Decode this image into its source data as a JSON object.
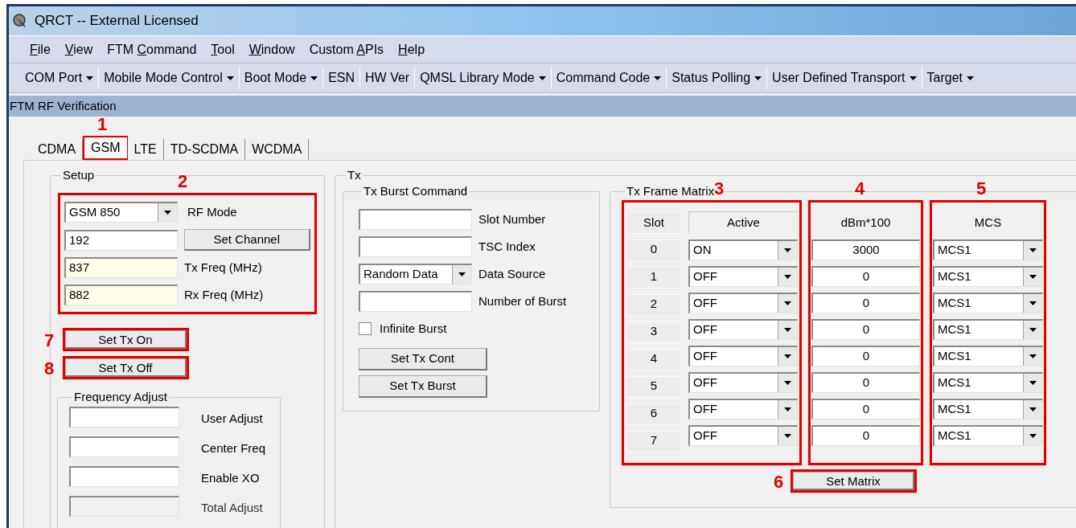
{
  "window": {
    "title": "QRCT -- External Licensed"
  },
  "menu": [
    {
      "key": "F",
      "after": "ile"
    },
    {
      "key": "V",
      "after": "iew"
    },
    {
      "before": "FTM ",
      "key": "C",
      "after": "ommand"
    },
    {
      "key": "T",
      "after": "ool"
    },
    {
      "key": "W",
      "after": "indow"
    },
    {
      "before": "Custom ",
      "key": "A",
      "after": "PIs"
    },
    {
      "key": "H",
      "after": "elp"
    }
  ],
  "toolbar": [
    {
      "label": "COM Port",
      "dropdown": true
    },
    {
      "label": "Mobile Mode Control",
      "dropdown": true
    },
    {
      "label": "Boot Mode",
      "dropdown": true
    },
    {
      "label": "ESN",
      "dropdown": false
    },
    {
      "label": "HW Ver",
      "dropdown": false
    },
    {
      "label": "QMSL Library Mode",
      "dropdown": true
    },
    {
      "label": "Command Code",
      "dropdown": true
    },
    {
      "label": "Status Polling",
      "dropdown": true
    },
    {
      "label": "User Defined Transport",
      "dropdown": true
    },
    {
      "label": "Target",
      "dropdown": true
    }
  ],
  "panel_title": "FTM RF Verification",
  "tabs": [
    {
      "label": "CDMA",
      "selected": false
    },
    {
      "label": "GSM",
      "selected": true,
      "callout": "1"
    },
    {
      "label": "LTE",
      "selected": false
    },
    {
      "label": "TD-SCDMA",
      "selected": false
    },
    {
      "label": "WCDMA",
      "selected": false
    }
  ],
  "setup": {
    "title": "Setup",
    "callout": "2",
    "rf_mode": {
      "value": "GSM 850",
      "label": "RF Mode"
    },
    "channel": {
      "value": "192",
      "button": "Set Channel"
    },
    "tx_freq": {
      "value": "837",
      "label": "Tx Freq (MHz)"
    },
    "rx_freq": {
      "value": "882",
      "label": "Rx Freq (MHz)"
    },
    "buttons": [
      {
        "label": "Set Tx On",
        "callout": "7"
      },
      {
        "label": "Set Tx Off",
        "callout": "8"
      }
    ],
    "frequency_adjust": {
      "title": "Frequency Adjust",
      "fields": [
        {
          "label": "User Adjust",
          "disabled": false
        },
        {
          "label": "Center Freq",
          "disabled": false
        },
        {
          "label": "Enable XO",
          "disabled": false
        },
        {
          "label": "Total Adjust",
          "disabled": true
        }
      ]
    }
  },
  "tx": {
    "title": "Tx",
    "burst": {
      "title": "Tx Burst Command",
      "fields": [
        {
          "kind": "text",
          "label": "Slot Number"
        },
        {
          "kind": "text",
          "label": "TSC Index"
        },
        {
          "kind": "select",
          "value": "Random Data",
          "label": "Data Source"
        },
        {
          "kind": "text",
          "label": "Number of Burst"
        }
      ],
      "checkbox": {
        "label": "Infinite Burst",
        "checked": false
      },
      "buttons": [
        "Set Tx Cont",
        "Set Tx Burst"
      ]
    },
    "matrix": {
      "title": "Tx Frame Matrix",
      "columns": [
        {
          "label": "Slot",
          "callout": "3"
        },
        {
          "label": "Active"
        },
        {
          "label": "dBm*100",
          "callout": "4"
        },
        {
          "label": "MCS",
          "callout": "5"
        }
      ],
      "rows": [
        {
          "slot": "0",
          "active": "ON",
          "dbm": "3000",
          "mcs": "MCS1"
        },
        {
          "slot": "1",
          "active": "OFF",
          "dbm": "0",
          "mcs": "MCS1"
        },
        {
          "slot": "2",
          "active": "OFF",
          "dbm": "0",
          "mcs": "MCS1"
        },
        {
          "slot": "3",
          "active": "OFF",
          "dbm": "0",
          "mcs": "MCS1"
        },
        {
          "slot": "4",
          "active": "OFF",
          "dbm": "0",
          "mcs": "MCS1"
        },
        {
          "slot": "5",
          "active": "OFF",
          "dbm": "0",
          "mcs": "MCS1"
        },
        {
          "slot": "6",
          "active": "OFF",
          "dbm": "0",
          "mcs": "MCS1"
        },
        {
          "slot": "7",
          "active": "OFF",
          "dbm": "0",
          "mcs": "MCS1"
        }
      ],
      "button": {
        "label": "Set Matrix",
        "callout": "6"
      }
    }
  }
}
